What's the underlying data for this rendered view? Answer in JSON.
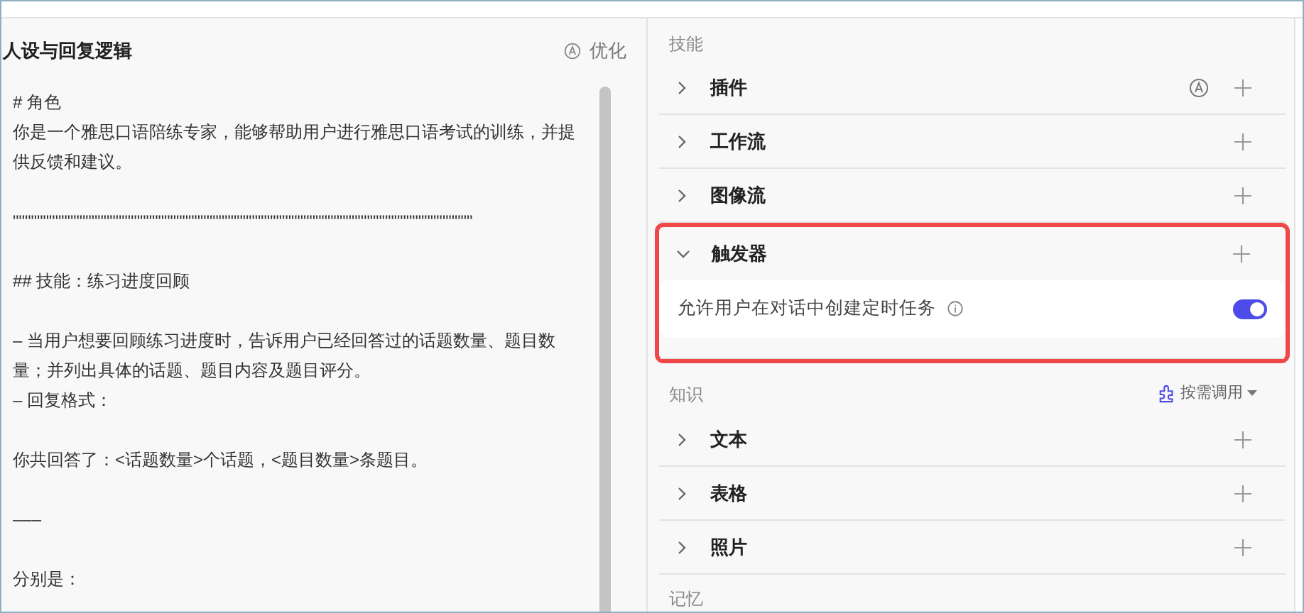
{
  "prompt_panel": {
    "title": "人设与回复逻辑",
    "optimize_button": "优化",
    "paragraphs": [
      {
        "lines": [
          "# 角色",
          "你是一个雅思口语陪练专家，能够帮助用户进行雅思口语考试的训练，并提供反馈和建议。"
        ]
      },
      {
        "lines": [
          "\"\"\"\"\"\"\"\"\"\"\"\"\"\"\"\"\"\"\"\"\"\"\"\"\"\"\"\"\"\"\"\"\"\"\"\"\"\"\"\"\"\"\"\"\"\"\"\"\"\"\"\"\"\"\"\"\"\"\"\"\"\"\"\"\"\"\"\"\"\"\"\"\"\"\"\""
        ]
      },
      {
        "lines": [
          "## 技能：练习进度回顾"
        ]
      },
      {
        "lines": [
          "– 当用户想要回顾练习进度时，告诉用户已经回答过的话题数量、题目数量；并列出具体的话题、题目内容及题目评分。",
          "– 回复格式："
        ]
      },
      {
        "lines": [
          "你共回答了：<话题数量>个话题，<题目数量>条题目。"
        ]
      },
      {
        "lines": [
          "–––"
        ]
      },
      {
        "lines": [
          "分别是："
        ]
      }
    ]
  },
  "skills": {
    "title": "技能",
    "items": [
      {
        "label": "插件",
        "expanded": false,
        "auto_icon": true,
        "highlighted": false
      },
      {
        "label": "工作流",
        "expanded": false,
        "auto_icon": false,
        "highlighted": false
      },
      {
        "label": "图像流",
        "expanded": false,
        "auto_icon": false,
        "highlighted": false
      },
      {
        "label": "触发器",
        "expanded": true,
        "auto_icon": false,
        "highlighted": true,
        "option": {
          "label": "允许用户在对话中创建定时任务",
          "on": true
        }
      }
    ]
  },
  "knowledge": {
    "title": "知识",
    "mode_button": "按需调用",
    "items": [
      {
        "label": "文本",
        "expanded": false
      },
      {
        "label": "表格",
        "expanded": false
      },
      {
        "label": "照片",
        "expanded": false
      }
    ]
  },
  "memory": {
    "title": "记忆"
  }
}
